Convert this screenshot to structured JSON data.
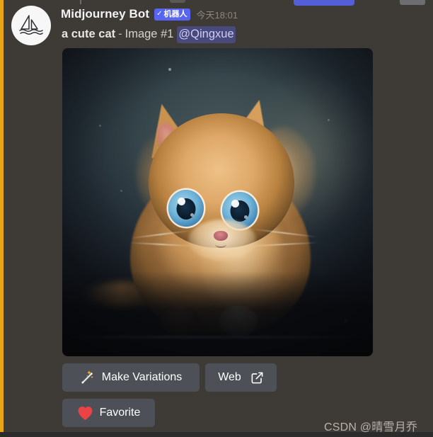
{
  "message": {
    "author": "Midjourney Bot",
    "bot_badge": {
      "check": "✓",
      "label": "机器人"
    },
    "timestamp": "今天18:01",
    "content": {
      "prompt": "a cute cat",
      "separator": "-",
      "image_label": "Image #1",
      "mention": "@Qingxue"
    },
    "attachment": {
      "alt": "a cute cat - Image #1",
      "description": "Fluffy orange kitten with large blue eyes on a dark teal background"
    }
  },
  "buttons": [
    {
      "name": "make-variations",
      "icon": "magic-wand-icon",
      "label": "Make Variations"
    },
    {
      "name": "web",
      "icon": "external-link-icon",
      "label": "Web"
    },
    {
      "name": "favorite",
      "icon": "heart-icon",
      "label": "Favorite"
    }
  ],
  "watermark": "CSDN @晴雪月乔",
  "colors": {
    "page_background": "#3e3a35",
    "accent_stripe": "#e8a317",
    "bot_badge": "#5865f2",
    "button": "#4e5058",
    "mention_pill": "#4a4a7a",
    "mention_text": "#c9cdfb",
    "heart": "#ed4245"
  }
}
